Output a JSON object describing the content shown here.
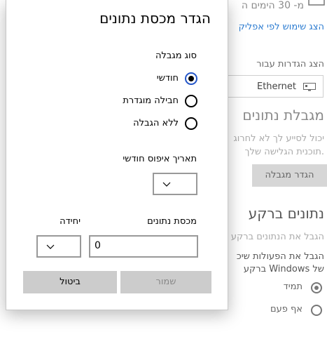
{
  "background": {
    "top_text": "מ- 30 הימים ה",
    "app_usage_link": "הצג שימוש לפי אפליק",
    "show_settings_for_label": "הצג הגדרות עבור",
    "network_value": "Ethernet",
    "data_limit_heading": "מגבלת נתונים",
    "data_limit_desc_1": "יכול לסייע לך לא לחרוג",
    "data_limit_desc_2": ".תוכנית הגלישה שלך",
    "set_limit_button": "הגדר מגבלה",
    "background_data_heading": "נתונים ברקע",
    "background_desc_1": "הגבל את הנתונים ברקע",
    "background_desc_2": "הגבל את הפעולות שיכ",
    "background_desc_3": "של Windows ברקע",
    "always_label": "תמיד",
    "never_label": "אף פעם"
  },
  "dialog": {
    "title": "הגדר מכסת נתונים",
    "limit_type_label": "סוג מגבלה",
    "options": [
      "חודשי",
      "חבילה מוגדרת",
      "ללא הגבלה"
    ],
    "selected_option": "חודשי",
    "reset_date_label": "תאריך איפוס חודשי",
    "reset_date_value": "",
    "quota_label": "מכסת נתונים",
    "quota_value": "0",
    "unit_label": "יחידה",
    "unit_value": "",
    "save_button": "שמור",
    "cancel_button": "ביטול"
  },
  "colors": {
    "accent": "#2456c8",
    "button_bg": "#cccccc",
    "link": "#2b7bd0"
  }
}
